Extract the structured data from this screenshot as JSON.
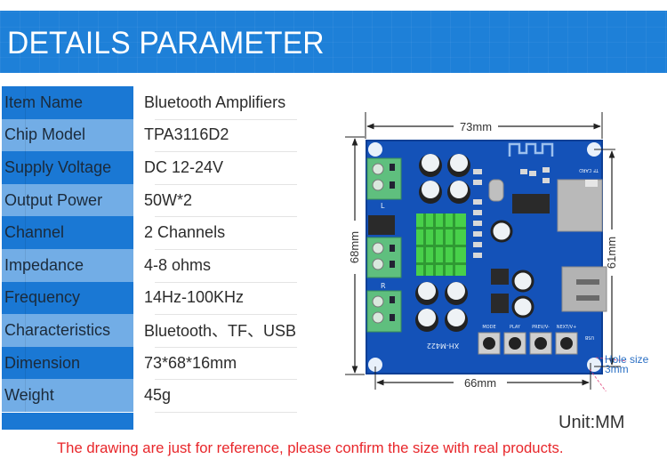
{
  "header": {
    "title": "DETAILS PARAMETER"
  },
  "specs": [
    {
      "label": "Item Name",
      "value": "Bluetooth Amplifiers"
    },
    {
      "label": "Chip Model",
      "value": "TPA3116D2"
    },
    {
      "label": "Supply Voltage",
      "value": "DC 12-24V"
    },
    {
      "label": "Output Power",
      "value": "50W*2"
    },
    {
      "label": "Channel",
      "value": "2 Channels"
    },
    {
      "label": "Impedance",
      "value": "4-8 ohms"
    },
    {
      "label": "Frequency",
      "value": "14Hz-100KHz"
    },
    {
      "label": "Characteristics",
      "value": "Bluetooth、TF、USB"
    },
    {
      "label": "Dimension",
      "value": "73*68*16mm"
    },
    {
      "label": "Weight",
      "value": "45g"
    }
  ],
  "diagram": {
    "width_label": "73mm",
    "height_label": "68mm",
    "inner_height_label": "61mm",
    "hole_spacing_label": "66mm",
    "hole_note_line1": "Hole size",
    "hole_note_line2": "3mm",
    "board_model": "XH-M422",
    "buttons": [
      "MODE",
      "PLAY",
      "PREV/V-",
      "NEXT/V+"
    ],
    "tf_label": "TF CARD",
    "usb_label": "USB",
    "left_channel": "L",
    "right_channel": "R"
  },
  "footer": {
    "unit": "Unit:MM",
    "disclaimer": "The drawing are just for reference, please confirm the size with real products."
  },
  "colors": {
    "header_blue": "#1e80d8",
    "row_dark": "#1a78d4",
    "row_light": "#72ade6",
    "pcb_blue": "#1452b8",
    "heatsink_green": "#4cd84a",
    "terminal_green": "#58b878",
    "disclaimer_red": "#e8262a",
    "hole_note_blue": "#2a6fc4"
  }
}
